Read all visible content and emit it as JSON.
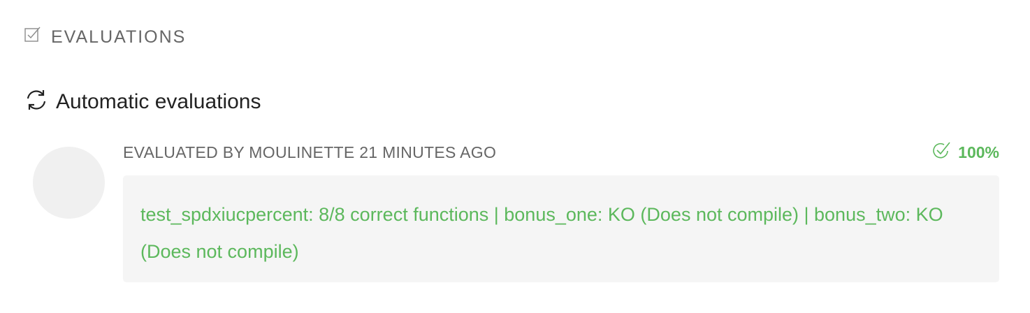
{
  "section": {
    "title": "EVALUATIONS",
    "icon": "checkbox-icon"
  },
  "automatic": {
    "title": "Automatic evaluations",
    "icon": "refresh-icon"
  },
  "evaluation": {
    "evaluated_by": "EVALUATED BY MOULINETTE 21 MINUTES AGO",
    "score": "100%",
    "score_icon": "check-circle-icon",
    "result_text": "test_spdxiucpercent: 8/8 correct functions | bonus_one: KO (Does not compile) | bonus_two: KO (Does not compile)"
  },
  "colors": {
    "success": "#5cb85c",
    "muted": "#666666",
    "box_background": "#f5f5f5",
    "avatar_background": "#f0f0f0"
  }
}
